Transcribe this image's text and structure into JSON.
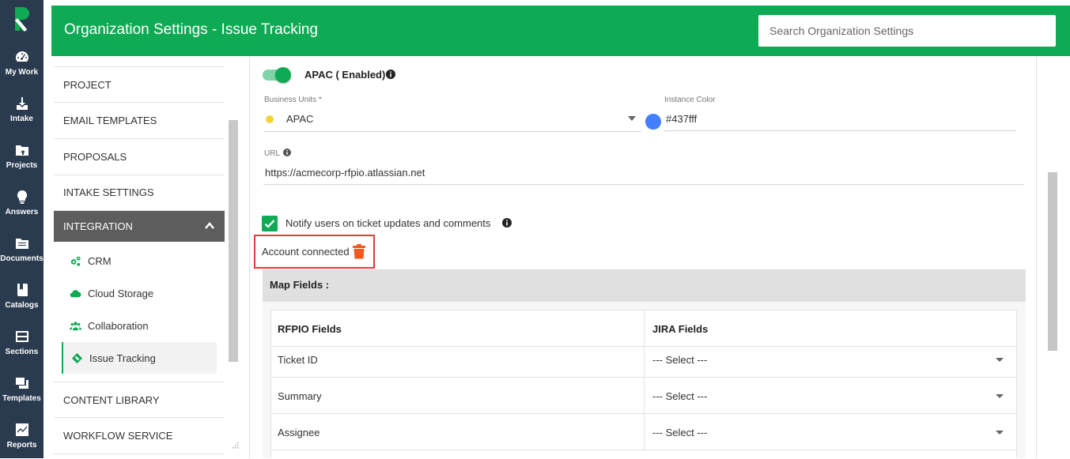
{
  "rail": {
    "items": [
      {
        "label": "My Work",
        "icon": "dashboard-icon"
      },
      {
        "label": "Intake",
        "icon": "intake-icon"
      },
      {
        "label": "Projects",
        "icon": "projects-icon"
      },
      {
        "label": "Answers",
        "icon": "lightbulb-icon"
      },
      {
        "label": "Documents",
        "icon": "documents-icon"
      },
      {
        "label": "Catalogs",
        "icon": "catalogs-icon"
      },
      {
        "label": "Sections",
        "icon": "sections-icon"
      },
      {
        "label": "Templates",
        "icon": "templates-icon"
      },
      {
        "label": "Reports",
        "icon": "reports-icon"
      }
    ]
  },
  "header": {
    "title": "Organization Settings - Issue Tracking",
    "search_placeholder": "Search Organization Settings",
    "color": "#0faa54"
  },
  "nav": {
    "items": [
      {
        "label": "PROJECT"
      },
      {
        "label": "EMAIL TEMPLATES"
      },
      {
        "label": "PROPOSALS"
      },
      {
        "label": "INTAKE SETTINGS"
      },
      {
        "label": "INTEGRATION",
        "expanded": true
      },
      {
        "label": "CONTENT LIBRARY"
      },
      {
        "label": "WORKFLOW SERVICE"
      }
    ],
    "sub_items": [
      {
        "label": "CRM",
        "icon": "gears-icon"
      },
      {
        "label": "Cloud Storage",
        "icon": "cloud-icon"
      },
      {
        "label": "Collaboration",
        "icon": "users-icon"
      },
      {
        "label": "Issue Tracking",
        "icon": "ticket-icon",
        "selected": true
      }
    ]
  },
  "instance": {
    "title": "APAC ( Enabled)",
    "enabled": true,
    "business_units_label": "Business Units *",
    "business_units_value": "APAC",
    "instance_color_label": "Instance Color",
    "instance_color_value": "#437fff",
    "url_label": "URL",
    "url_value": "https://acmecorp-rfpio.atlassian.net",
    "notify_label": "Notify users on ticket updates and comments",
    "notify_checked": true,
    "account_status": "Account connected"
  },
  "map_fields": {
    "title": "Map Fields :",
    "headers": [
      "RFPIO Fields",
      "JIRA Fields"
    ],
    "rows": [
      {
        "field": "Ticket ID",
        "select": "--- Select ---"
      },
      {
        "field": "Summary",
        "select": "--- Select ---"
      },
      {
        "field": "Assignee",
        "select": "--- Select ---"
      }
    ]
  }
}
